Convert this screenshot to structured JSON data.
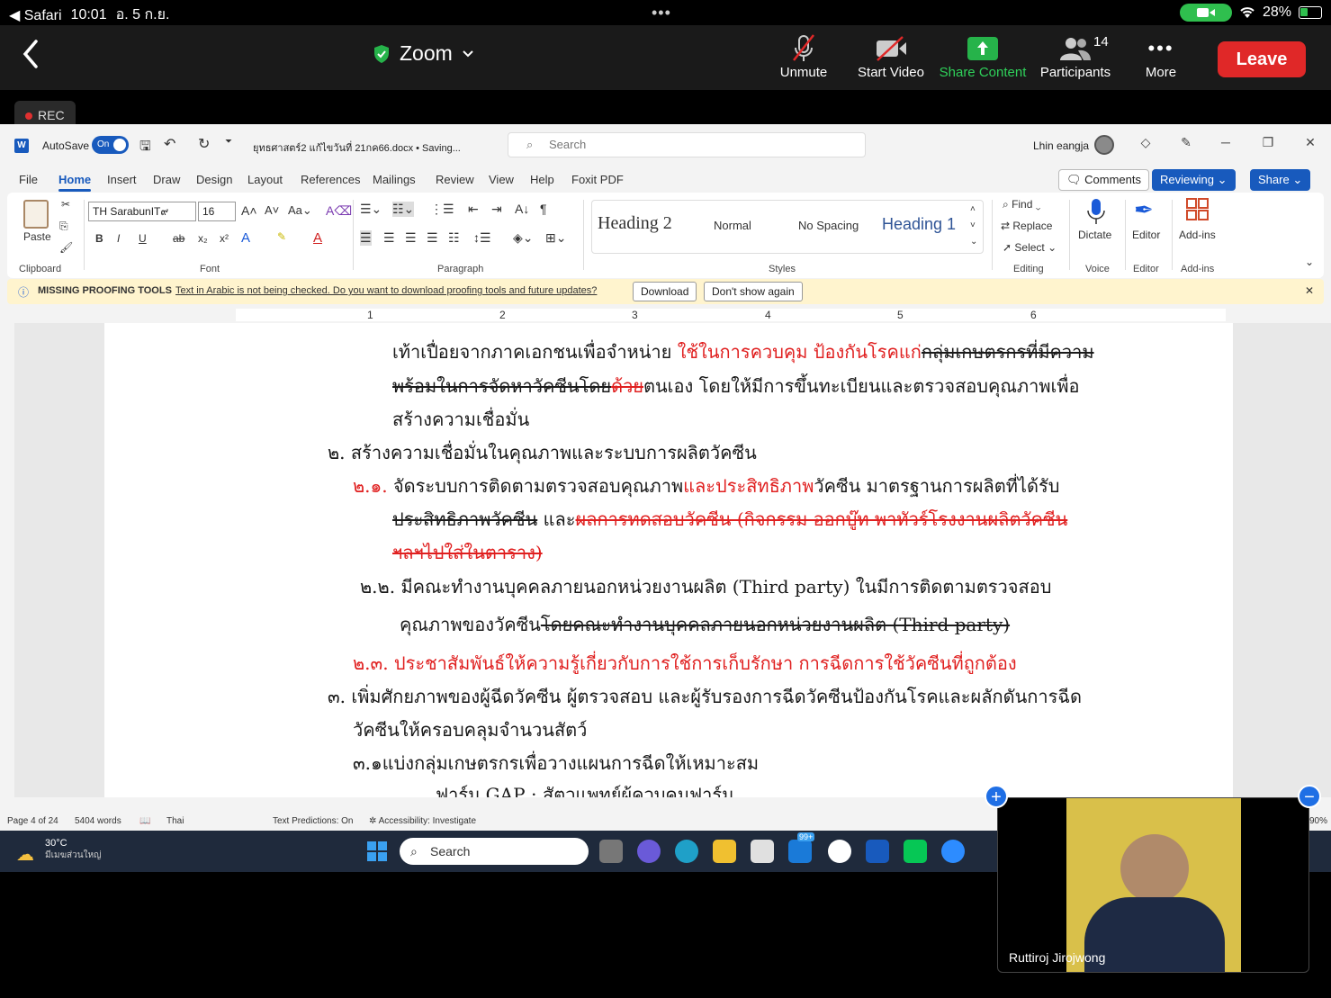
{
  "ios": {
    "back_app": "◀ Safari",
    "time": "10:01",
    "date": "อ. 5 ก.ย.",
    "battery": "28%"
  },
  "zoom": {
    "title": "Zoom",
    "unmute": "Unmute",
    "start_video": "Start Video",
    "share_content": "Share Content",
    "participants": "Participants",
    "participants_count": "14",
    "more": "More",
    "leave": "Leave",
    "rec": "REC"
  },
  "word": {
    "autosave": "AutoSave",
    "autosave_state": "On",
    "filename": "ยุทธศาสตร์2 แก้ไขวันที่ 21กค66.docx • Saving...",
    "search_placeholder": "Search",
    "user": "Lhin eangja",
    "menu": [
      "File",
      "Home",
      "Insert",
      "Draw",
      "Design",
      "Layout",
      "References",
      "Mailings",
      "Review",
      "View",
      "Help",
      "Foxit PDF"
    ],
    "comments": "Comments",
    "reviewing": "Reviewing",
    "share": "Share",
    "ribbon": {
      "paste": "Paste",
      "clipboard": "Clipboard",
      "font_name": "TH SarabunIT๙",
      "font_size": "16",
      "font_group": "Font",
      "paragraph_group": "Paragraph",
      "styles": [
        "Heading 2",
        "Normal",
        "No Spacing",
        "Heading 1"
      ],
      "styles_group": "Styles",
      "find": "Find",
      "replace": "Replace",
      "select": "Select",
      "editing_group": "Editing",
      "dictate": "Dictate",
      "voice_group": "Voice",
      "editor": "Editor",
      "editor_group": "Editor",
      "addins": "Add-ins",
      "addins_group": "Add-ins"
    },
    "infobar": {
      "title": "MISSING PROOFING TOOLS",
      "message": "Text in Arabic is not being checked. Do you want to download proofing tools and future updates?",
      "download": "Download",
      "dont_show": "Don't show again"
    },
    "ruler_numbers": [
      "1",
      "2",
      "3",
      "4",
      "5",
      "6"
    ],
    "doc": {
      "l1a": "เท้าเปื่อยจากภาคเอกชนเพื่อจำหน่าย ",
      "l1b": "ใช้ในการควบคุม ป้องกันโรคแก่",
      "l1c": "กลุ่มเกษตรกรที่มีความ",
      "l2a": "พร้อมในการจัดหาวัคซีนโดย",
      "l2b": "ด้วย",
      "l2c": "ตนเอง โดยให้มีการขึ้นทะเบียนและตรวจสอบคุณภาพเพื่อ",
      "l3": "สร้างความเชื่อมั่น",
      "l4": "๒. สร้างความเชื่อมั่นในคุณภาพและระบบการผลิตวัคซีน",
      "l5a": "๒.๑. ",
      "l5b": "จัดระบบการติดตามตรวจสอบคุณภาพ",
      "l5c": "และประสิทธิภาพ",
      "l5d": "วัคซีน มาตรฐานการผลิตที่ได้รับ",
      "l6a": "ประสิทธิภาพวัคซีน",
      "l6b": "   และ",
      "l6c": "ผลการทดสอบวัคซีน (กิจกรรม ออกบู๊ท พาทัวร์โรงงานผลิตวัคซีน",
      "l7": "ฯลฯไปใส่ในตาราง)",
      "l8": "๒.๒. มีคณะทำงานบุคคลภายนอกหน่วยงานผลิต (Third party) ในมีการติดตามตรวจสอบ",
      "l9a": "คุณภาพของวัคซีน",
      "l9b": "โดยคณะทำงานบุคคลภายนอกหน่วยงานผลิต (Third party)",
      "l10": "๒.๓. ประชาสัมพันธ์ให้ความรู้เกี่ยวกับการใช้การเก็บรักษา การฉีดการใช้วัคซีนที่ถูกต้อง",
      "l11": "๓. เพิ่มศักยภาพของผู้ฉีดวัคซีน ผู้ตรวจสอบ และผู้รับรองการฉีดวัคซีนป้องกันโรคและผลักดันการฉีด",
      "l12": "วัคซีนให้ครอบคลุมจำนวนสัตว์",
      "l13": "๓.๑แบ่งกลุ่มเกษตรกรเพื่อวางแผนการฉีดให้เหมาะสม",
      "l14": "ฟาร์ม GAP : สัตวแพทย์ผู้ควบคุมฟาร์ม"
    },
    "status": {
      "page": "Page 4 of 24",
      "words": "5404 words",
      "lang": "Thai",
      "predictions": "Text Predictions: On",
      "accessibility": "Accessibility: Investigate",
      "zoom_pct": "90%"
    }
  },
  "taskbar": {
    "temp": "30°C",
    "weather": "มีเมฆส่วนใหญ่",
    "search": "Search",
    "badge": "99+"
  },
  "video": {
    "name": "Ruttiroj Jirojwong"
  }
}
